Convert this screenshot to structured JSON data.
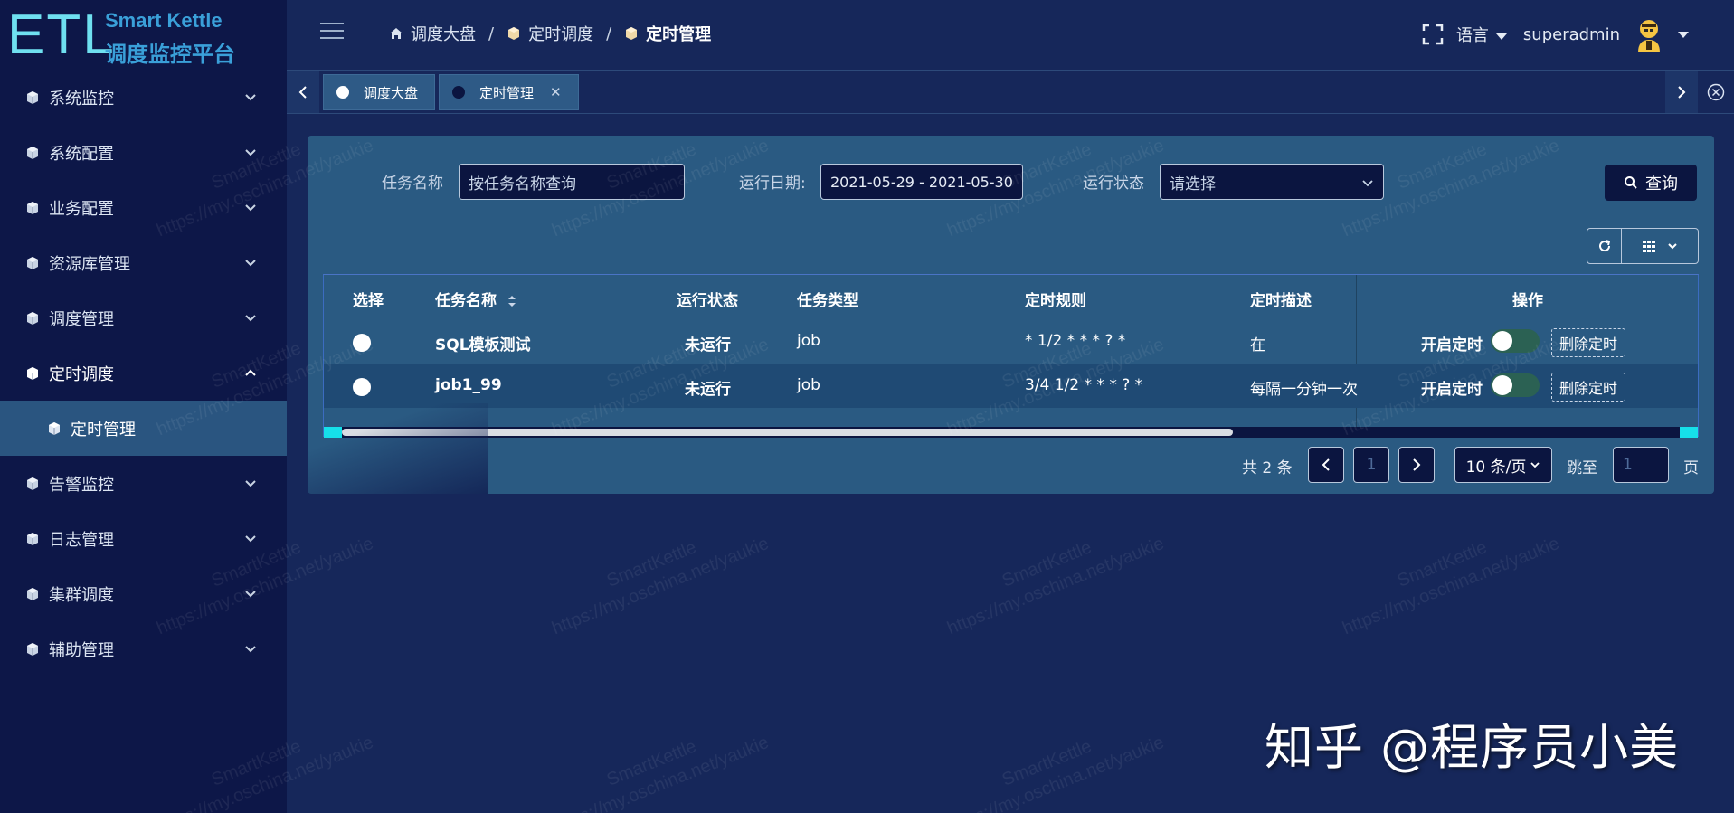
{
  "logo": {
    "mark": "ETL",
    "title": "Smart Kettle",
    "subtitle": "调度监控平台"
  },
  "sidebar": {
    "items": [
      {
        "label": "系统监控"
      },
      {
        "label": "系统配置"
      },
      {
        "label": "业务配置"
      },
      {
        "label": "资源库管理"
      },
      {
        "label": "调度管理"
      },
      {
        "label": "定时调度"
      },
      {
        "label": "告警监控"
      },
      {
        "label": "日志管理"
      },
      {
        "label": "集群调度"
      },
      {
        "label": "辅助管理"
      }
    ],
    "sub_item": {
      "label": "定时管理"
    }
  },
  "breadcrumb": {
    "home": "调度大盘",
    "level2": "定时调度",
    "current": "定时管理"
  },
  "topbar": {
    "language": "语言",
    "user": "superadmin"
  },
  "tabs": [
    {
      "label": "调度大盘",
      "dot_color": "#ffffff"
    },
    {
      "label": "定时管理",
      "dot_color": "#0b1540"
    }
  ],
  "filters": {
    "task_name_label": "任务名称",
    "task_name_placeholder": "按任务名称查询",
    "run_date_label": "运行日期:",
    "run_date_value": "2021-05-29 - 2021-05-30",
    "run_status_label": "运行状态",
    "run_status_placeholder": "请选择",
    "search_label": "查询"
  },
  "table": {
    "headers": {
      "select": "选择",
      "name": "任务名称",
      "status": "运行状态",
      "type": "任务类型",
      "rule": "定时规则",
      "desc": "定时描述",
      "ops": "操作"
    },
    "rows": [
      {
        "name": "SQL模板测试",
        "status": "未运行",
        "type": "job",
        "rule": "* 1/2 * * * ? *",
        "desc": "在",
        "enable_label": "开启定时",
        "delete_label": "删除定时"
      },
      {
        "name": "job1_99",
        "status": "未运行",
        "type": "job",
        "rule": "3/4 1/2 * * * ? *",
        "desc": "每隔一分钟一次",
        "enable_label": "开启定时",
        "delete_label": "删除定时"
      }
    ]
  },
  "pagination": {
    "total": "共 2 条",
    "current_page": "1",
    "page_size": "10 条/页",
    "jump_label": "跳至",
    "jump_value": "1",
    "page_unit": "页"
  },
  "watermark": {
    "line1": "SmartKettle",
    "line2": "https://my.oschina.net/yaukie"
  },
  "brand": "知乎 @程序员小美",
  "colors": {
    "accent": "#16e0ea",
    "sidebar_bg": "#0d1748",
    "panel_bg": "#2a5a82",
    "active_menu": "#2a5580"
  }
}
